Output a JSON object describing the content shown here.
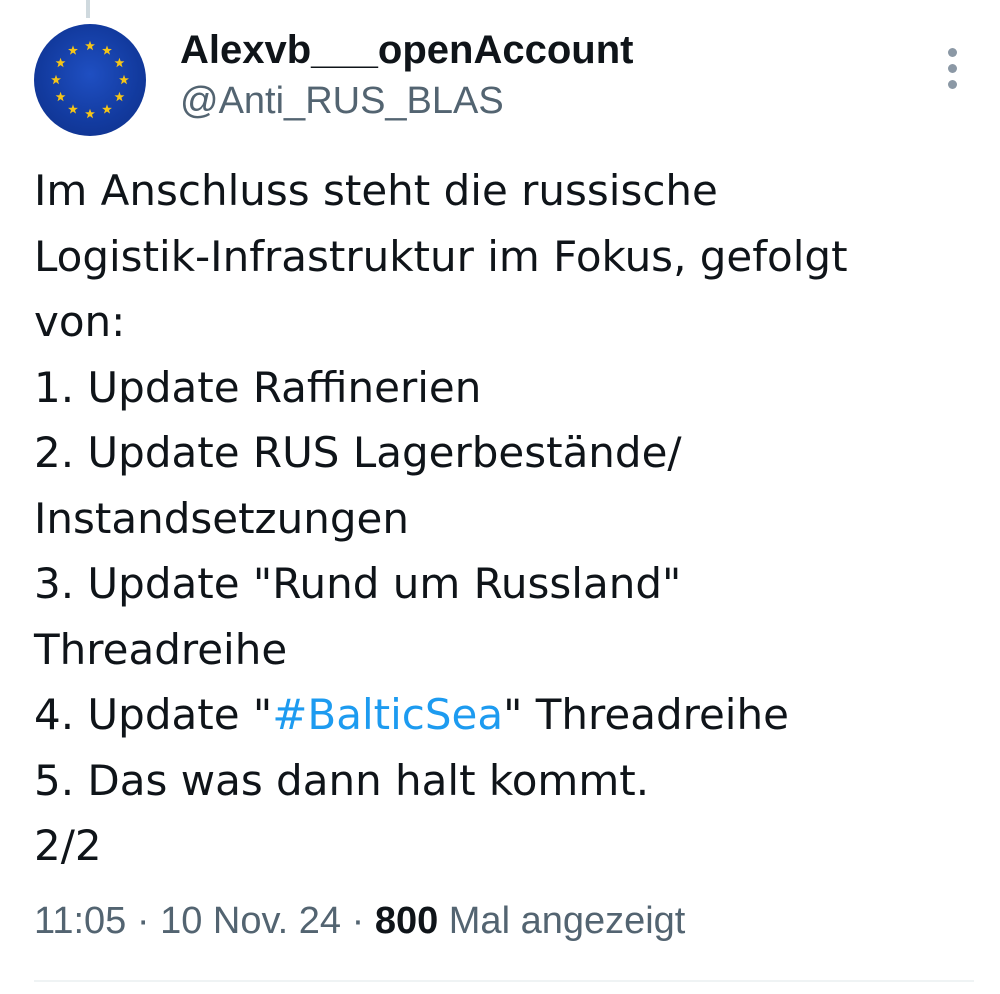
{
  "author": {
    "display_name": "Alexvb___openAccount",
    "handle": "@Anti_RUS_BLAS",
    "avatar_icon": "eu-flag-icon"
  },
  "more_icon": "more-vertical-icon",
  "tweet": {
    "lines": [
      "Im Anschluss steht die russische",
      "Logistik-Infrastruktur im Fokus, gefolgt",
      "von:",
      "1. Update Raffinerien",
      "2. Update RUS Lagerbestände/",
      "Instandsetzungen",
      "3. Update \"Rund um Russland\"",
      "Threadreihe"
    ],
    "line9_prefix": "4. Update \"",
    "hashtag": "#BalticSea",
    "line9_suffix": "\" Threadreihe",
    "line10": "5. Das was dann halt kommt.",
    "line11": "2/2"
  },
  "meta": {
    "time": "11:05",
    "separator": " · ",
    "date": "10 Nov. 24",
    "view_count": "800",
    "views_label": " Mal angezeigt"
  },
  "colors": {
    "text": "#0f1419",
    "secondary": "#536471",
    "link": "#1d9bf0",
    "avatar_blue": "#123a9e",
    "star_yellow": "#f5c518"
  }
}
